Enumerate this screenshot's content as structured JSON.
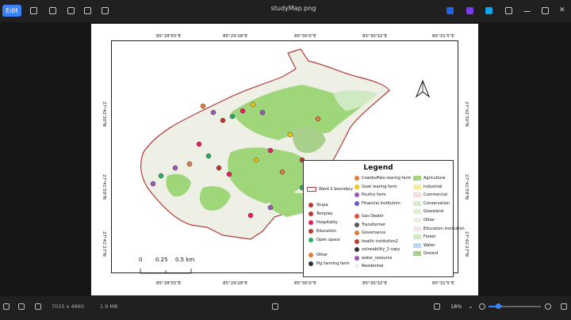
{
  "window": {
    "title": "studyMap.png",
    "edit_label": "Edit"
  },
  "map": {
    "top_coords": [
      "85°28'55\"E",
      "85°29'28\"E",
      "85°30'0\"E",
      "85°30'32\"E",
      "85°31'5\"E"
    ],
    "bottom_coords": [
      "85°28'55\"E",
      "85°29'28\"E",
      "85°30'0\"E",
      "85°30'32\"E",
      "85°31'5\"E"
    ],
    "left_coords": [
      "27°42'30\"N",
      "27°41'59\"N",
      "27°41'27\"N"
    ],
    "right_coords": [
      "27°42'30\"N",
      "27°41'59\"N",
      "27°41'27\"N"
    ],
    "scale": {
      "zero": "0",
      "mid": "0.25",
      "end": "0.5 km"
    },
    "legend": {
      "title": "Legend",
      "boundary": "Ward 2 boundary",
      "col1": [
        "Stupa",
        "Temples",
        "Hospitality",
        "Education",
        "Open space",
        "Other",
        "Pig farming farm"
      ],
      "col2": [
        "Cow/buffalo rearing farm",
        "Goat rearing farm",
        "Poultry farm",
        "Financial Institution",
        "Gas Dealer",
        "Transformer",
        "Governance",
        "health institution2",
        "vulneability_2 copy",
        "water_resource",
        "Residential"
      ],
      "col3": [
        "Agriculture",
        "Industrial",
        "Commercial",
        "Conservation",
        "Grassland",
        "Other",
        "Education institution",
        "Forest",
        "Water",
        "Ground"
      ],
      "col3_colors": [
        "#9fd67a",
        "#f3ee9a",
        "#f6dede",
        "#d8ecd0",
        "#dff0d8",
        "#efefe6",
        "#f2e6ea",
        "#cfe9c3",
        "#bcd9ef",
        "#a9cf8c"
      ]
    }
  },
  "status": {
    "dimensions": "7015 x 4960",
    "filesize": "1.9 MB",
    "zoom": "18%",
    "zoom_level": 0.18
  }
}
